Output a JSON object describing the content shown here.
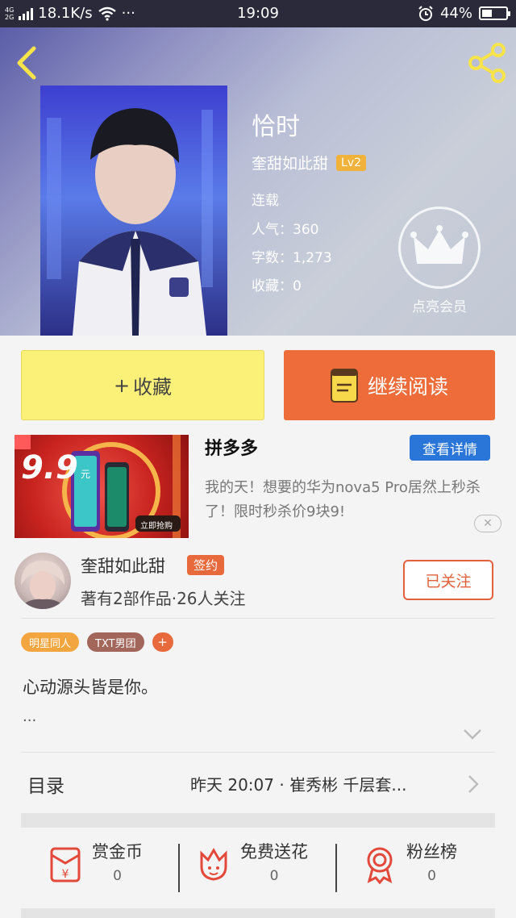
{
  "status_bar": {
    "network_top": "4G",
    "network_bottom": "2G",
    "speed": "18.1K/s",
    "dots": "···",
    "time": "19:09",
    "battery": "44%",
    "battery_level": 0.44
  },
  "book": {
    "title": "恰时",
    "author": "奎甜如此甜",
    "level": "Lv2",
    "status": "连载",
    "popularity": "人气：360",
    "word_count": "字数：1,273",
    "favorites": "收藏：0",
    "member_label": "点亮会员"
  },
  "actions": {
    "collect_label": "收藏",
    "collect_prefix": "+",
    "read_label": "继续阅读"
  },
  "ad": {
    "brand": "拼多多",
    "detail_button": "查看详情",
    "text": "我的天！想要的华为nova5 Pro居然上秒杀了！限时秒杀价9块9!",
    "price_text": "9.9",
    "price_unit": "元",
    "buy_button": "立即抢购"
  },
  "author_block": {
    "name": "奎甜如此甜",
    "signed_badge": "签约",
    "stats": "著有2部作品·26人关注",
    "follow_button": "已关注"
  },
  "tags": [
    "明星同人",
    "TXT男团",
    "+"
  ],
  "intro": {
    "text": "心动源头皆是你。",
    "more": "..."
  },
  "catalog": {
    "label": "目录",
    "latest": "昨天 20:07 · 崔秀彬 千层套..."
  },
  "stats": [
    {
      "label": "赏金币",
      "count": "0",
      "icon": "red-envelope-icon"
    },
    {
      "label": "免费送花",
      "count": "0",
      "icon": "flower-icon"
    },
    {
      "label": "粉丝榜",
      "count": "0",
      "icon": "medal-icon"
    }
  ],
  "colors": {
    "accent_orange": "#ee6c3a",
    "collect_yellow": "#fbf178",
    "detail_blue": "#2a76d8",
    "level_badge": "#f0b23a"
  }
}
